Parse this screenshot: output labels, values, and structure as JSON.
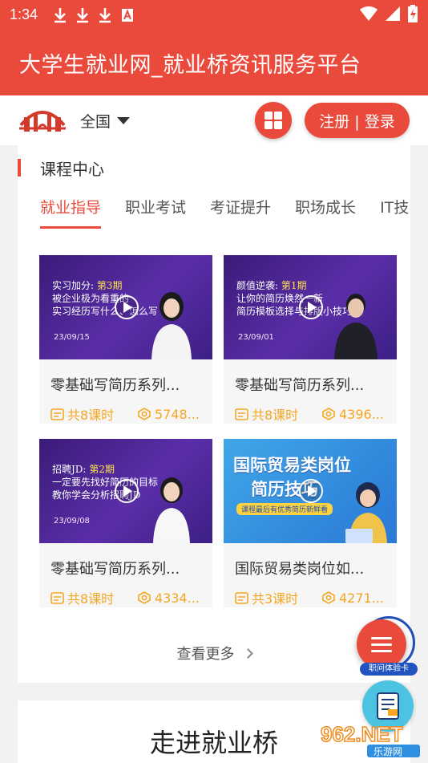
{
  "status_bar": {
    "time": "1:34"
  },
  "app": {
    "title": "大学生就业网_就业桥资讯服务平台"
  },
  "nav": {
    "region": "全国",
    "login_label": "注册 | 登录"
  },
  "section": {
    "title": "课程中心",
    "tabs": [
      "就业指导",
      "职业考试",
      "考证提升",
      "职场成长",
      "IT技"
    ],
    "active_tab": 0
  },
  "courses": [
    {
      "title": "零基础写简历系列...",
      "lessons": "共8课时",
      "views": "5748...",
      "thumb": {
        "style": "purple",
        "l1": "实习加分:",
        "episode": "第3期",
        "l2": "被企业极为看重的",
        "l3": "实习经历写什么、怎么写",
        "date": "23/09/15"
      }
    },
    {
      "title": "零基础写简历系列...",
      "lessons": "共8课时",
      "views": "4396...",
      "thumb": {
        "style": "purple",
        "l1": "颜值逆袭:",
        "episode": "第1期",
        "l2": "让你的简历焕然一新",
        "l3": "简历模板选择与排版小技巧",
        "date": "23/09/01"
      }
    },
    {
      "title": "零基础写简历系列...",
      "lessons": "共8课时",
      "views": "4334...",
      "thumb": {
        "style": "purple",
        "l1": "招聘JD:",
        "episode": "第2期",
        "l2": "一定要先找好简历的目标",
        "l3": "教你学会分析招聘JD",
        "date": "23/09/08"
      }
    },
    {
      "title": "国际贸易类岗位如...",
      "lessons": "共3课时",
      "views": "4271...",
      "thumb": {
        "style": "blue",
        "l1": "国际贸易类岗位",
        "l2": "简历技巧",
        "l3": "课程最后有优秀简历新鲜看"
      }
    }
  ],
  "more_label": "查看更多",
  "section2": {
    "title": "走进就业桥"
  },
  "fab": {
    "label": "职问体验卡"
  },
  "watermark": {
    "text": "962.NET",
    "sub": "乐游网"
  },
  "colors": {
    "brand": "#ea4a3c",
    "accent": "#f5a623"
  }
}
